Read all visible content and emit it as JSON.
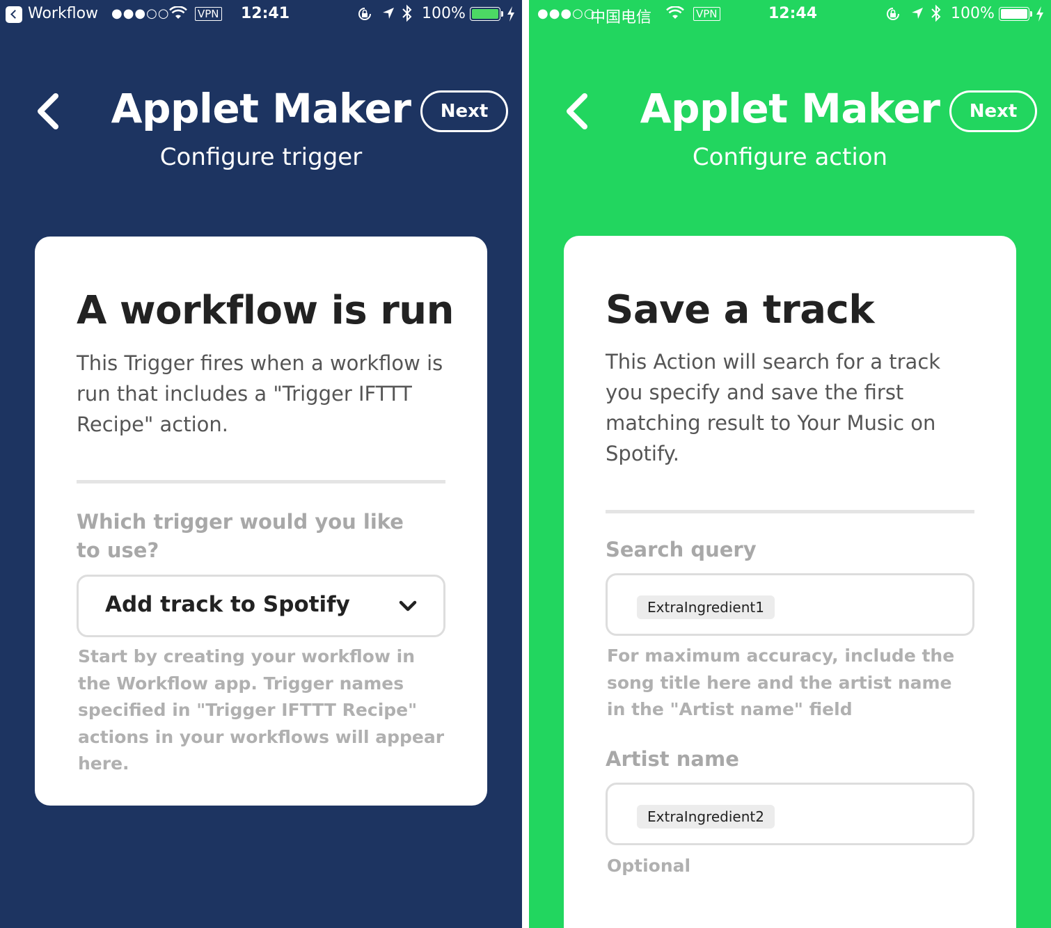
{
  "left": {
    "status_bar": {
      "back_app": "Workflow",
      "signal": "●●●○○",
      "vpn": "VPN",
      "time": "12:41",
      "battery": "100%",
      "battery_color": "#4cd964"
    },
    "header": {
      "title": "Applet Maker",
      "subtitle": "Configure trigger",
      "next_label": "Next",
      "background": "#1d3461"
    },
    "card": {
      "title": "A workflow is run",
      "description": "This Trigger fires when a workflow is run that includes a \"Trigger IFTTT Recipe\" action.",
      "field_label": "Which trigger would you like to use?",
      "selected_value": "Add track to Spotify",
      "help_text": "Start by creating your workflow in the Workflow app. Trigger names specified in \"Trigger IFTTT Recipe\" actions in your workflows will appear here."
    }
  },
  "right": {
    "status_bar": {
      "signal": "●●●○○",
      "carrier": "中国电信",
      "vpn": "VPN",
      "time": "12:44",
      "battery": "100%",
      "battery_color": "#ffffff"
    },
    "header": {
      "title": "Applet Maker",
      "subtitle": "Configure action",
      "next_label": "Next",
      "background": "#22d65f"
    },
    "card": {
      "title": "Save a track",
      "description": "This Action will search for a track you specify and save the first matching result to Your Music on Spotify.",
      "search_label": "Search query",
      "search_value": "ExtraIngredient1",
      "search_help": "For maximum accuracy, include the song title here and the artist name in the \"Artist name\" field",
      "artist_label": "Artist name",
      "artist_value": "ExtraIngredient2",
      "artist_help": "Optional"
    }
  }
}
